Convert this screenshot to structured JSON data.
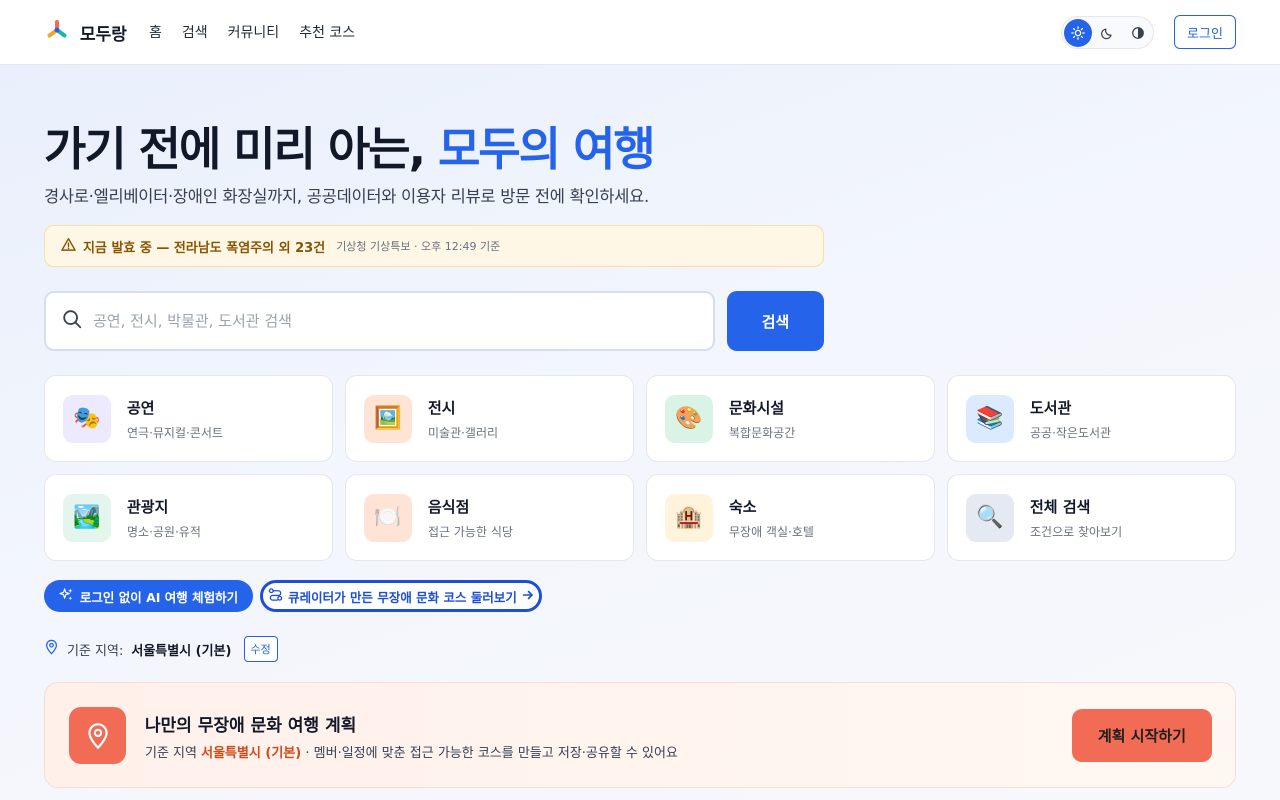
{
  "header": {
    "logo_text": "모두랑",
    "nav": [
      "홈",
      "검색",
      "커뮤니티",
      "추천 코스"
    ],
    "theme_icons": [
      "sun-icon",
      "moon-icon",
      "contrast-icon"
    ],
    "login_label": "로그인"
  },
  "hero": {
    "title_prefix": "가기 전에 미리 아는, ",
    "title_accent": "모두의 여행",
    "subtitle": "경사로·엘리베이터·장애인 화장실까지, 공공데이터와 이용자 리뷰로 방문 전에 확인하세요."
  },
  "alert": {
    "main": "지금 발효 중 — 전라남도 폭염주의 외 23건",
    "meta": "기상청 기상특보 · 오후 12:49 기준"
  },
  "search": {
    "placeholder": "공연, 전시, 박물관, 도서관 검색",
    "value": "",
    "button": "검색"
  },
  "categories": [
    {
      "title": "공연",
      "desc": "연극·뮤지컬·콘서트",
      "icon": "🎭",
      "bg": "#ede9fe"
    },
    {
      "title": "전시",
      "desc": "미술관·갤러리",
      "icon": "🖼️",
      "bg": "#ffe4d6"
    },
    {
      "title": "문화시설",
      "desc": "복합문화공간",
      "icon": "🎨",
      "bg": "#d9f3e7"
    },
    {
      "title": "도서관",
      "desc": "공공·작은도서관",
      "icon": "📚",
      "bg": "#dbeafe"
    },
    {
      "title": "관광지",
      "desc": "명소·공원·유적",
      "icon": "🏞️",
      "bg": "#e3f5ec"
    },
    {
      "title": "음식점",
      "desc": "접근 가능한 식당",
      "icon": "🍽️",
      "bg": "#ffe4d6"
    },
    {
      "title": "숙소",
      "desc": "무장애 객실·호텔",
      "icon": "🏨",
      "bg": "#fff3dc"
    },
    {
      "title": "전체 검색",
      "desc": "조건으로 찾아보기",
      "icon": "🔍",
      "bg": "#e5e9f2"
    }
  ],
  "actions": {
    "ai_trial": "로그인 없이 AI 여행 체험하기",
    "curated_courses": "큐레이터가 만든 무장애 문화 코스 둘러보기"
  },
  "region": {
    "label": "기준 지역:",
    "value": "서울특별시 (기본)",
    "edit": "수정"
  },
  "plan": {
    "title": "나만의 무장애 문화 여행 계획",
    "desc_prefix": "기준 지역 ",
    "desc_region": "서울특별시 (기본)",
    "desc_suffix": " · 멤버·일정에 맞춘 접근 가능한 코스를 만들고 저장·공유할 수 있어요",
    "button": "계획 시작하기"
  },
  "colors": {
    "primary": "#2563eb",
    "alert_bg": "#fff7e6",
    "alert_text": "#8a5300",
    "plan_accent": "#f26b55"
  }
}
